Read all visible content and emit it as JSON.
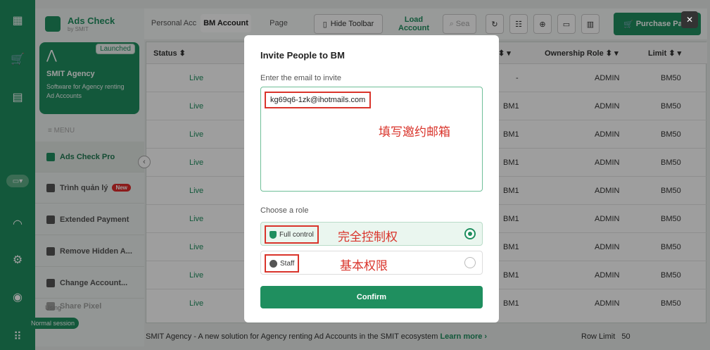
{
  "colors": {
    "brand": "#1f8f5f",
    "annotation": "#d9342b"
  },
  "rail": {
    "icons": [
      "grid-icon",
      "cart-icon",
      "clipboard-icon",
      "flag-icon",
      "headset-icon",
      "gear-icon",
      "user-circle-icon",
      "apps-icon"
    ]
  },
  "sidebar": {
    "app_name": "Ads Check",
    "app_sub": "by SMIT",
    "badge": "Launched",
    "agency_name": "SMIT Agency",
    "agency_desc": "Software for Agency renting Ad Accounts",
    "menu_header": "≡ MENU",
    "items": [
      {
        "label": "Ads Check Pro",
        "active": true
      },
      {
        "label": "Trình quản lý",
        "badge": "New"
      },
      {
        "label": "Extended Payment"
      },
      {
        "label": "Remove Hidden A..."
      },
      {
        "label": "Change Account..."
      },
      {
        "label": "Share Pixel"
      }
    ],
    "using": "Using",
    "session": "Normal session"
  },
  "toolbar": {
    "tabs": [
      "Personal Acc",
      "BM Account",
      "Page"
    ],
    "selected_tab": "BM Account",
    "hide_toolbar": "Hide Toolbar",
    "load_account_1": "Load",
    "load_account_2": "Account",
    "search_placeholder": "Sea",
    "purchase": "Purchase Pack"
  },
  "table": {
    "headers": [
      "Status ⬍",
      "⬍ ▾",
      "Ownership Role ⬍ ▾",
      "Limit ⬍ ▾"
    ],
    "rows": [
      {
        "status": "Live",
        "bm": "-",
        "role": "ADMIN",
        "limit": "BM50"
      },
      {
        "status": "Live",
        "bm": "BM1",
        "role": "ADMIN",
        "limit": "BM50"
      },
      {
        "status": "Live",
        "bm": "BM1",
        "role": "ADMIN",
        "limit": "BM50"
      },
      {
        "status": "Live",
        "bm": "BM1",
        "role": "ADMIN",
        "limit": "BM50"
      },
      {
        "status": "Live",
        "bm": "BM1",
        "role": "ADMIN",
        "limit": "BM50"
      },
      {
        "status": "Live",
        "bm": "BM1",
        "role": "ADMIN",
        "limit": "BM50"
      },
      {
        "status": "Live",
        "bm": "BM1",
        "role": "ADMIN",
        "limit": "BM50"
      },
      {
        "status": "Live",
        "bm": "BM1",
        "role": "ADMIN",
        "limit": "BM50"
      },
      {
        "status": "Live",
        "bm": "BM1",
        "role": "ADMIN",
        "limit": "BM50"
      }
    ]
  },
  "footer": {
    "text": "SMIT Agency - A new solution for Agency renting Ad Accounts in the SMIT ecosystem",
    "learn_more": "Learn more ›",
    "row_limit_label": "Row Limit",
    "row_limit_value": "50"
  },
  "modal": {
    "title": "Invite People to BM",
    "email_label": "Enter the email to invite",
    "email_value": "kg69q6-1zk@ihotmails.com",
    "email_annotation": "填写邀约邮箱",
    "role_label": "Choose a role",
    "options": [
      {
        "label": "Full control",
        "annotation": "完全控制权",
        "selected": true
      },
      {
        "label": "Staff",
        "annotation": "基本权限",
        "selected": false
      }
    ],
    "confirm": "Confirm"
  }
}
